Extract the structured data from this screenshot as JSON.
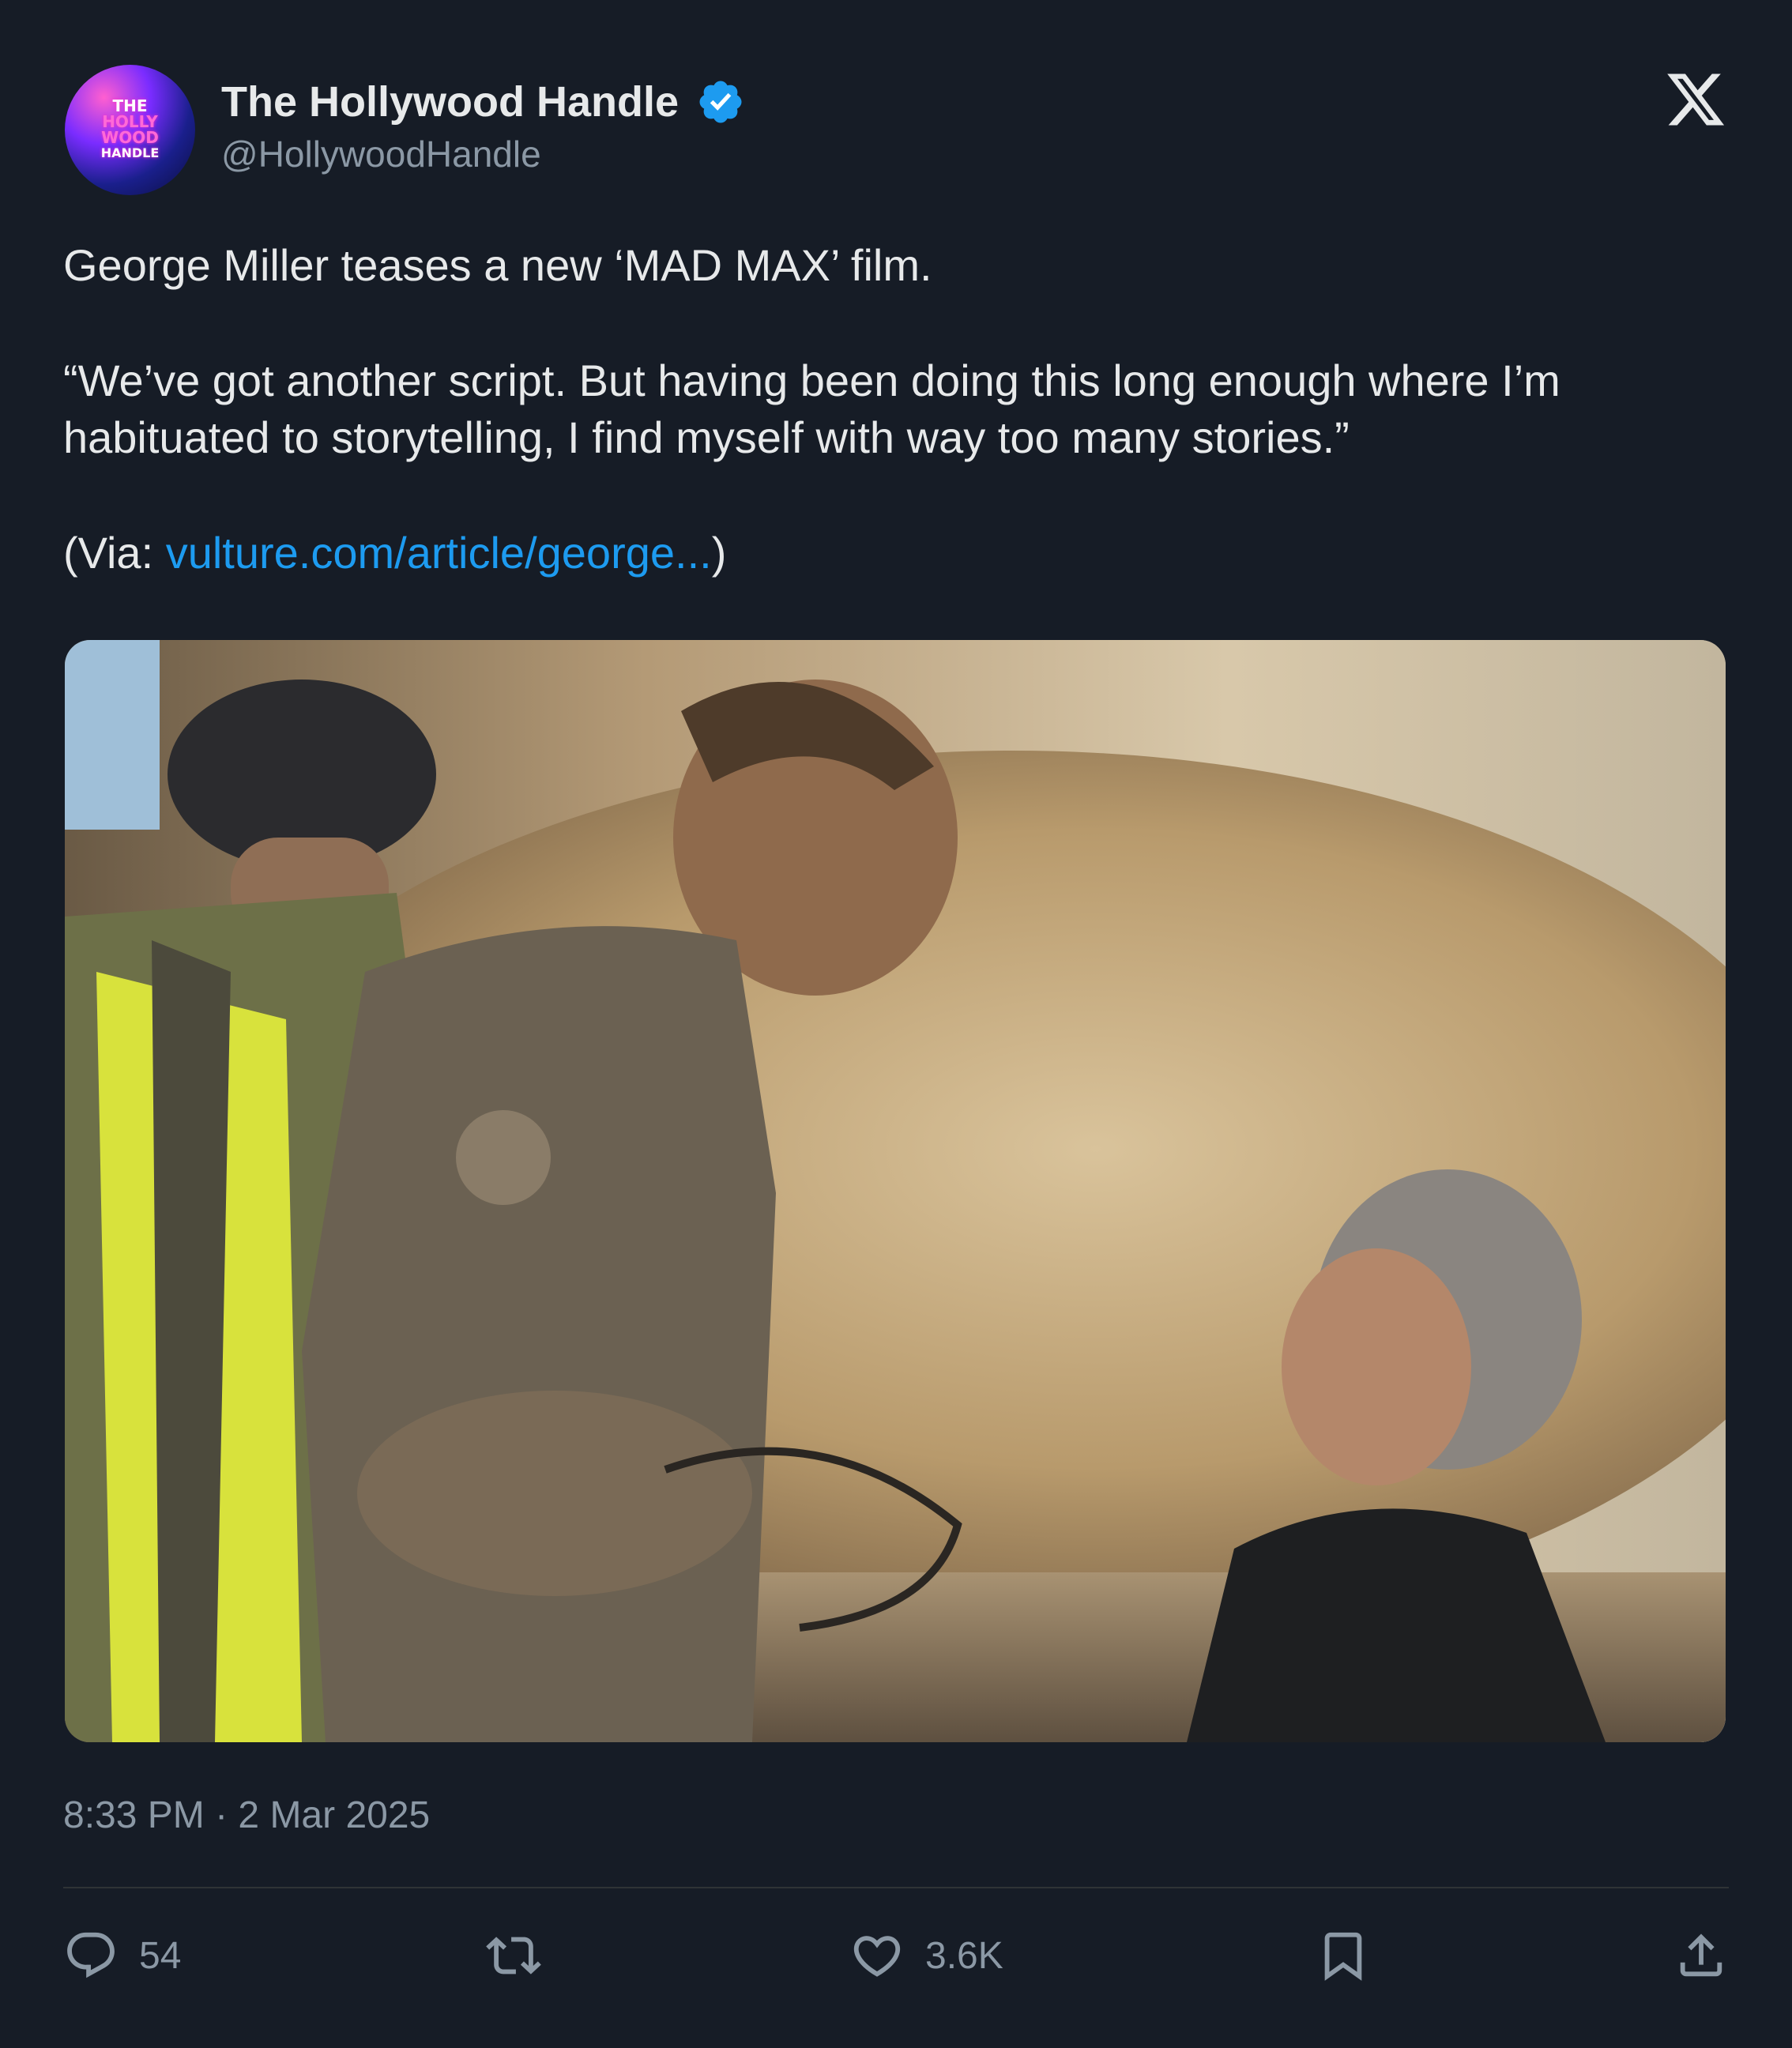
{
  "post": {
    "author": {
      "display_name": "The Hollywood Handle",
      "handle": "@HollywoodHandle",
      "avatar_text": [
        "THE",
        "HOLLY",
        "WOOD",
        "HANDLE"
      ]
    },
    "text": {
      "line1": "George Miller teases a new ‘MAD MAX’ film.",
      "quote": "“We’ve got another script. But having been doing this long enough where I’m habituated to storytelling, I find myself with way too many stories.”",
      "via_prefix": "(Via: ",
      "via_link": "vulture.com/article/george...",
      "via_suffix": ")"
    },
    "timestamp": "8:33 PM · 2 Mar 2025",
    "actions": {
      "replies": "54",
      "reposts": "",
      "likes": "3.6K"
    }
  },
  "icons": {
    "verified": "verified-badge-icon",
    "brand": "x-logo-icon",
    "reply": "reply-icon",
    "repost": "repost-icon",
    "like": "heart-icon",
    "bookmark": "bookmark-icon",
    "share": "share-icon"
  },
  "colors": {
    "background": "#161c26",
    "text": "#e7e9ea",
    "secondary": "#8b98a5",
    "link": "#1d9bf0",
    "verified": "#1d9bf0"
  }
}
